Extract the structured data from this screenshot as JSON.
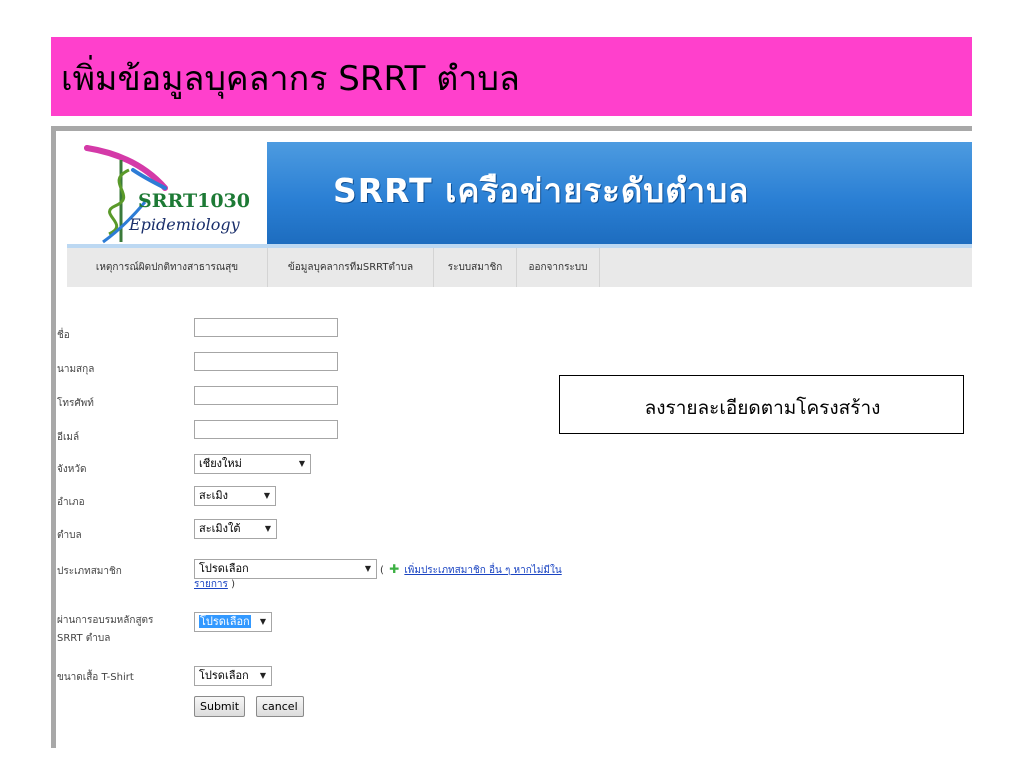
{
  "slide_title": "เพิ่มข้อมูลบุคลากร SRRT ตำบล",
  "banner": {
    "logo_name": "SRRT1030",
    "logo_sub": "Epidemiology",
    "title": "SRRT เครือข่ายระดับตำบล"
  },
  "nav": {
    "items": [
      "เหตุการณ์ผิดปกติทางสาธารณสุข",
      "ข้อมูลบุคลากรทีมSRRTตำบล",
      "ระบบสมาชิก",
      "ออกจากระบบ"
    ]
  },
  "form": {
    "first_name_label": "ชื่อ",
    "first_name_value": "",
    "last_name_label": "นามสกุล",
    "last_name_value": "",
    "phone_label": "โทรศัพท์",
    "phone_value": "",
    "email_label": "อีเมล์",
    "email_value": "",
    "province_label": "จังหวัด",
    "province_value": "เชียงใหม่",
    "district_label": "อำเภอ",
    "district_value": "สะเมิง",
    "subdistrict_label": "ตำบล",
    "subdistrict_value": "สะเมิงใต้",
    "member_type_label": "ประเภทสมาชิก",
    "member_type_value": "โปรดเลือก",
    "member_type_note_open": "(",
    "member_type_link_1": "เพิ่มประเภทสมาชิก อื่น ๆ หากไม่มีใน",
    "member_type_link_2": "รายการ",
    "member_type_note_close": ")",
    "training_label_1": "ผ่านการอบรมหลักสูตร",
    "training_label_2": "SRRT ตำบล",
    "training_value": "โปรดเลือก",
    "shirt_label": "ขนาดเสื้อ T-Shirt",
    "shirt_value": "โปรดเลือก",
    "submit_label": "Submit",
    "cancel_label": "cancel"
  },
  "callout": "ลงรายละเอียดตามโครงสร้าง",
  "colors": {
    "title_bar": "#ff40cc",
    "banner_blue": "#2a7fd4",
    "link": "#1a44c2",
    "nav_bg": "#e9e9e9"
  }
}
